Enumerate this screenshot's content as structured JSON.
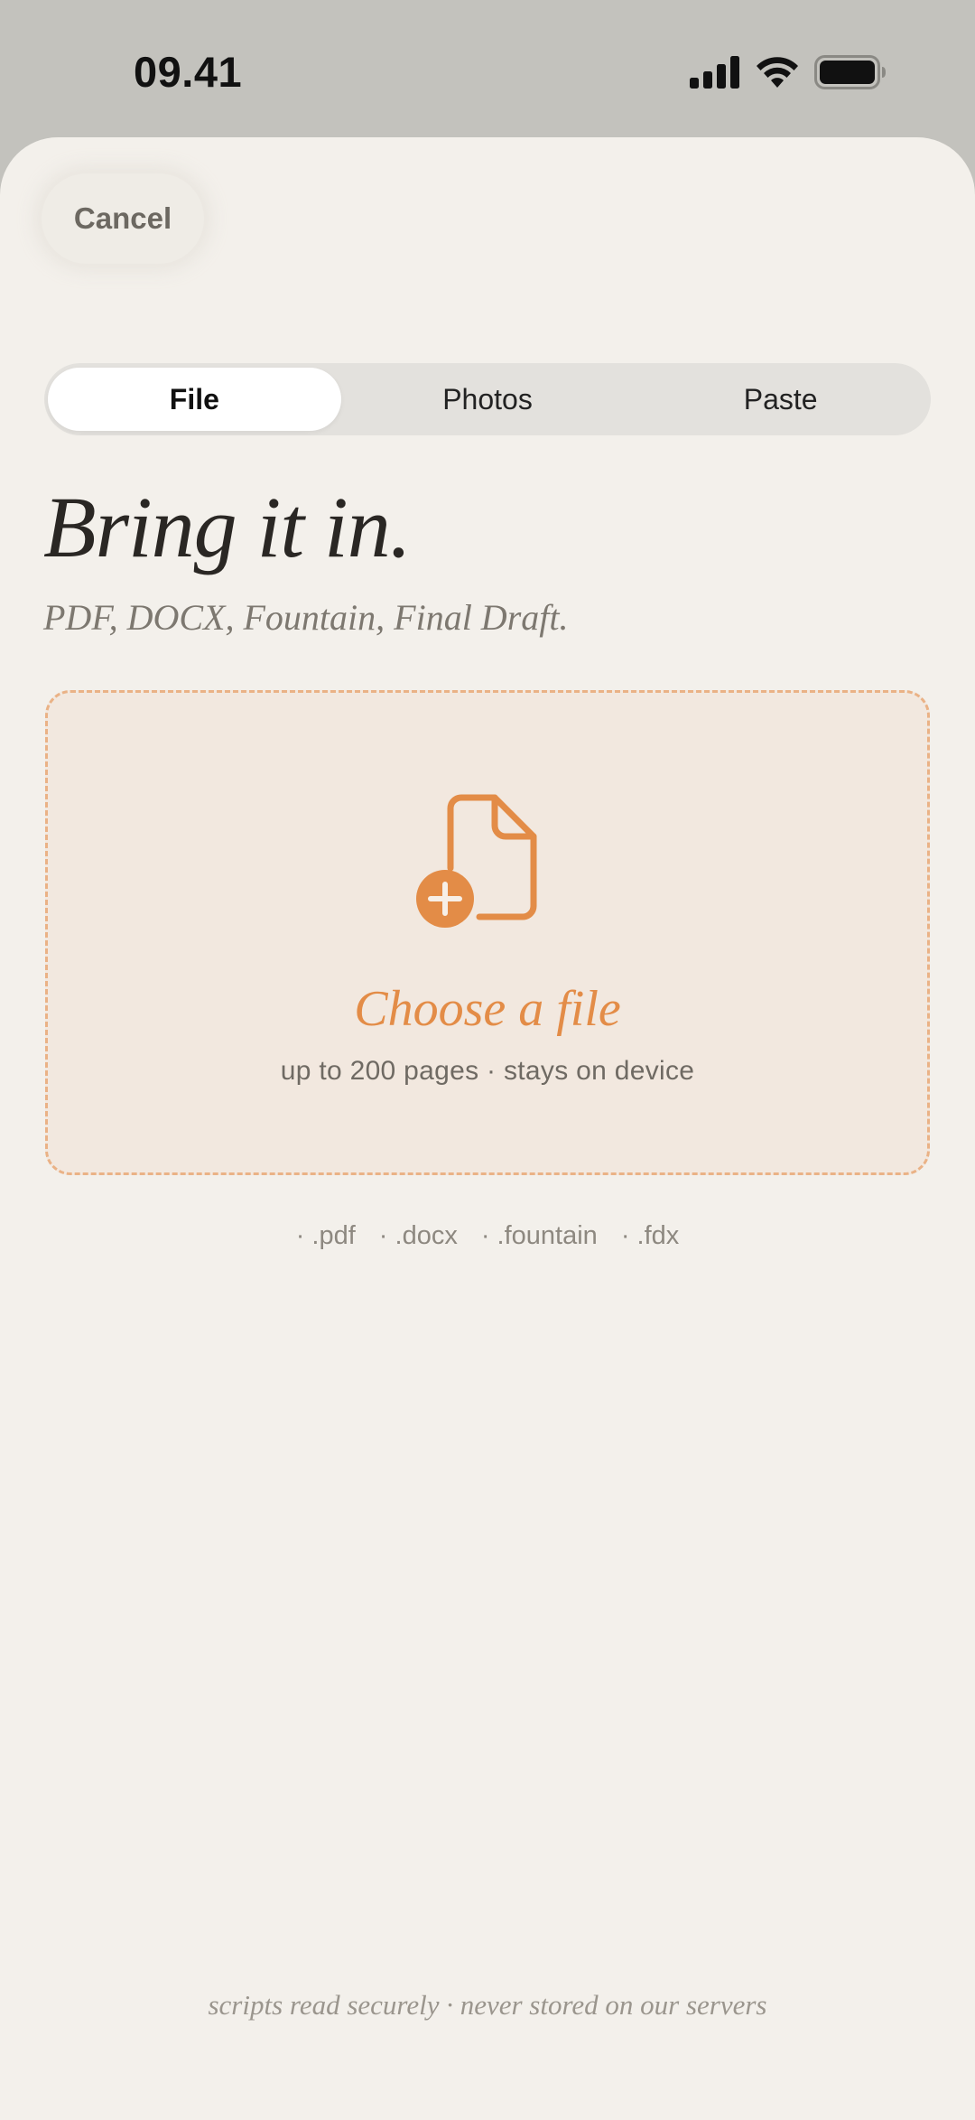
{
  "status_bar": {
    "time": "09.41",
    "icons": [
      "cellular-signal-icon",
      "wifi-icon",
      "battery-icon"
    ]
  },
  "sheet": {
    "cancel_label": "Cancel",
    "tabs": [
      {
        "label": "File",
        "active": true
      },
      {
        "label": "Photos",
        "active": false
      },
      {
        "label": "Paste",
        "active": false
      }
    ],
    "headline": "Bring it in.",
    "subtitle": "PDF, DOCX, Fountain, Final Draft.",
    "dropzone": {
      "icon": "file-plus-icon",
      "title": "Choose a file",
      "subtitle": "up to 200 pages · stays on device"
    },
    "extensions": [
      "· .pdf",
      "· .docx",
      "· .fountain",
      "· .fdx"
    ],
    "footer": "scripts read securely · never stored on our servers"
  },
  "colors": {
    "accent": "#e38c47",
    "sheet_background": "#f3f0eb",
    "status_background": "#c3c2bd",
    "dropzone_border": "#eab286",
    "dropzone_fill": "#f2e8df"
  }
}
